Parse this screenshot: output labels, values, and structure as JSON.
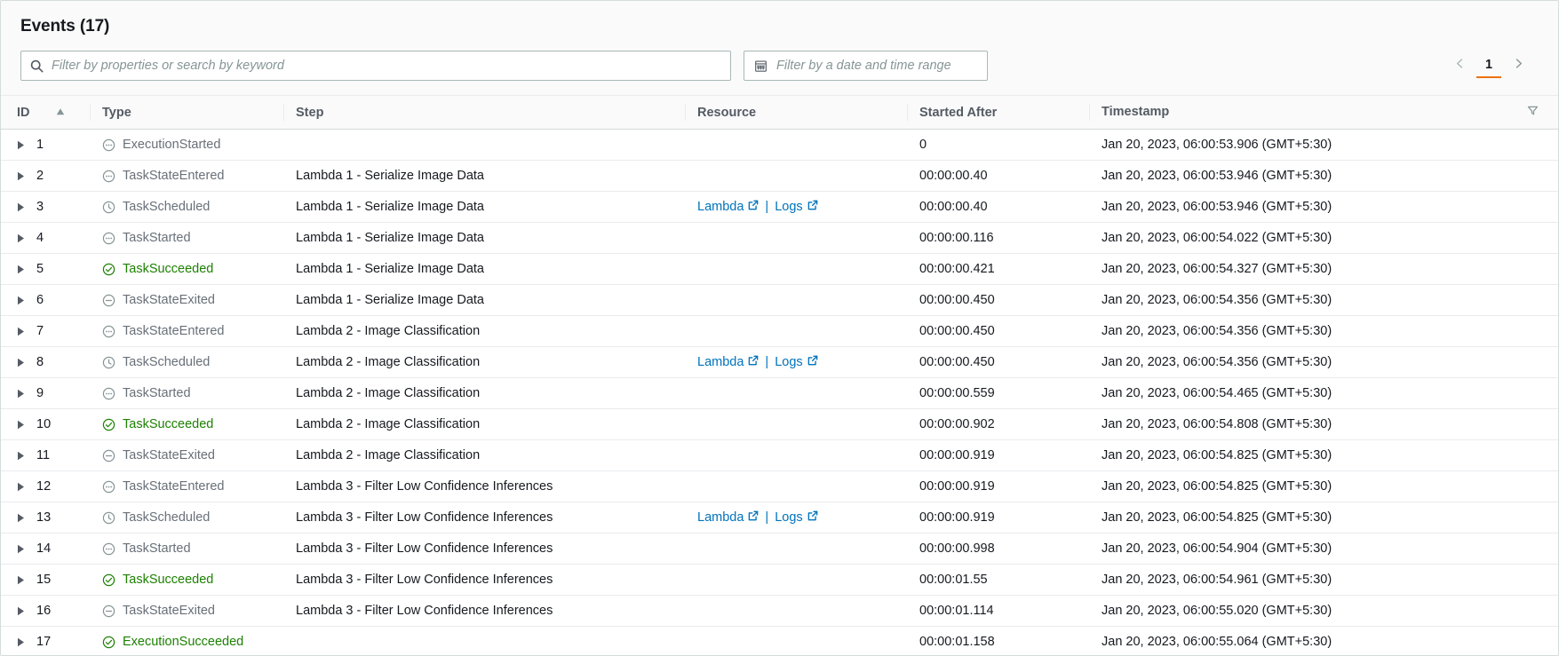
{
  "header": {
    "title": "Events (17)",
    "search": {
      "placeholder": "Filter by properties or search by keyword",
      "value": "",
      "icon": "search-icon"
    },
    "date_filter": {
      "placeholder": "Filter by a date and time range",
      "icon": "calendar-icon"
    },
    "pagination": {
      "prev_icon": "chevron-left-icon",
      "next_icon": "chevron-right-icon",
      "current_page": "1"
    }
  },
  "table": {
    "columns": [
      {
        "key": "id",
        "label": "ID",
        "sort_icon": "sort-ascending-icon"
      },
      {
        "key": "type",
        "label": "Type"
      },
      {
        "key": "step",
        "label": "Step"
      },
      {
        "key": "resource",
        "label": "Resource"
      },
      {
        "key": "started",
        "label": "Started After"
      },
      {
        "key": "timestamp",
        "label": "Timestamp"
      }
    ],
    "preferences_icon": "filter-funnel-icon",
    "row_expand_icon": "expand-triangle-icon",
    "resource_link_icon": "external-link-icon",
    "resource_separator": "|",
    "rows": [
      {
        "id": "1",
        "type": "ExecutionStarted",
        "type_state": "pending",
        "type_icon": "ellipsis-circle-icon",
        "step": "",
        "resource": [],
        "started": "0",
        "timestamp": "Jan 20, 2023, 06:00:53.906 (GMT+5:30)"
      },
      {
        "id": "2",
        "type": "TaskStateEntered",
        "type_state": "pending",
        "type_icon": "ellipsis-circle-icon",
        "step": "Lambda 1 - Serialize Image Data",
        "resource": [],
        "started": "00:00:00.40",
        "timestamp": "Jan 20, 2023, 06:00:53.946 (GMT+5:30)"
      },
      {
        "id": "3",
        "type": "TaskScheduled",
        "type_state": "pending",
        "type_icon": "clock-circle-icon",
        "step": "Lambda 1 - Serialize Image Data",
        "resource": [
          "Lambda",
          "Logs"
        ],
        "started": "00:00:00.40",
        "timestamp": "Jan 20, 2023, 06:00:53.946 (GMT+5:30)"
      },
      {
        "id": "4",
        "type": "TaskStarted",
        "type_state": "pending",
        "type_icon": "ellipsis-circle-icon",
        "step": "Lambda 1 - Serialize Image Data",
        "resource": [],
        "started": "00:00:00.116",
        "timestamp": "Jan 20, 2023, 06:00:54.022 (GMT+5:30)"
      },
      {
        "id": "5",
        "type": "TaskSucceeded",
        "type_state": "success",
        "type_icon": "check-circle-icon",
        "step": "Lambda 1 - Serialize Image Data",
        "resource": [],
        "started": "00:00:00.421",
        "timestamp": "Jan 20, 2023, 06:00:54.327 (GMT+5:30)"
      },
      {
        "id": "6",
        "type": "TaskStateExited",
        "type_state": "exited",
        "type_icon": "minus-circle-icon",
        "step": "Lambda 1 - Serialize Image Data",
        "resource": [],
        "started": "00:00:00.450",
        "timestamp": "Jan 20, 2023, 06:00:54.356 (GMT+5:30)"
      },
      {
        "id": "7",
        "type": "TaskStateEntered",
        "type_state": "pending",
        "type_icon": "ellipsis-circle-icon",
        "step": "Lambda 2 - Image Classification",
        "resource": [],
        "started": "00:00:00.450",
        "timestamp": "Jan 20, 2023, 06:00:54.356 (GMT+5:30)"
      },
      {
        "id": "8",
        "type": "TaskScheduled",
        "type_state": "pending",
        "type_icon": "clock-circle-icon",
        "step": "Lambda 2 - Image Classification",
        "resource": [
          "Lambda",
          "Logs"
        ],
        "started": "00:00:00.450",
        "timestamp": "Jan 20, 2023, 06:00:54.356 (GMT+5:30)"
      },
      {
        "id": "9",
        "type": "TaskStarted",
        "type_state": "pending",
        "type_icon": "ellipsis-circle-icon",
        "step": "Lambda 2 - Image Classification",
        "resource": [],
        "started": "00:00:00.559",
        "timestamp": "Jan 20, 2023, 06:00:54.465 (GMT+5:30)"
      },
      {
        "id": "10",
        "type": "TaskSucceeded",
        "type_state": "success",
        "type_icon": "check-circle-icon",
        "step": "Lambda 2 - Image Classification",
        "resource": [],
        "started": "00:00:00.902",
        "timestamp": "Jan 20, 2023, 06:00:54.808 (GMT+5:30)"
      },
      {
        "id": "11",
        "type": "TaskStateExited",
        "type_state": "exited",
        "type_icon": "minus-circle-icon",
        "step": "Lambda 2 - Image Classification",
        "resource": [],
        "started": "00:00:00.919",
        "timestamp": "Jan 20, 2023, 06:00:54.825 (GMT+5:30)"
      },
      {
        "id": "12",
        "type": "TaskStateEntered",
        "type_state": "pending",
        "type_icon": "ellipsis-circle-icon",
        "step": "Lambda 3 - Filter Low Confidence Inferences",
        "resource": [],
        "started": "00:00:00.919",
        "timestamp": "Jan 20, 2023, 06:00:54.825 (GMT+5:30)"
      },
      {
        "id": "13",
        "type": "TaskScheduled",
        "type_state": "pending",
        "type_icon": "clock-circle-icon",
        "step": "Lambda 3 - Filter Low Confidence Inferences",
        "resource": [
          "Lambda",
          "Logs"
        ],
        "started": "00:00:00.919",
        "timestamp": "Jan 20, 2023, 06:00:54.825 (GMT+5:30)"
      },
      {
        "id": "14",
        "type": "TaskStarted",
        "type_state": "pending",
        "type_icon": "ellipsis-circle-icon",
        "step": "Lambda 3 - Filter Low Confidence Inferences",
        "resource": [],
        "started": "00:00:00.998",
        "timestamp": "Jan 20, 2023, 06:00:54.904 (GMT+5:30)"
      },
      {
        "id": "15",
        "type": "TaskSucceeded",
        "type_state": "success",
        "type_icon": "check-circle-icon",
        "step": "Lambda 3 - Filter Low Confidence Inferences",
        "resource": [],
        "started": "00:00:01.55",
        "timestamp": "Jan 20, 2023, 06:00:54.961 (GMT+5:30)"
      },
      {
        "id": "16",
        "type": "TaskStateExited",
        "type_state": "exited",
        "type_icon": "minus-circle-icon",
        "step": "Lambda 3 - Filter Low Confidence Inferences",
        "resource": [],
        "started": "00:00:01.114",
        "timestamp": "Jan 20, 2023, 06:00:55.020 (GMT+5:30)"
      },
      {
        "id": "17",
        "type": "ExecutionSucceeded",
        "type_state": "success",
        "type_icon": "check-circle-icon",
        "step": "",
        "resource": [],
        "started": "00:00:01.158",
        "timestamp": "Jan 20, 2023, 06:00:55.064 (GMT+5:30)"
      }
    ]
  },
  "colors": {
    "accent": "#ec7211",
    "link": "#0073bb",
    "success": "#1d8102",
    "muted": "#687078"
  }
}
